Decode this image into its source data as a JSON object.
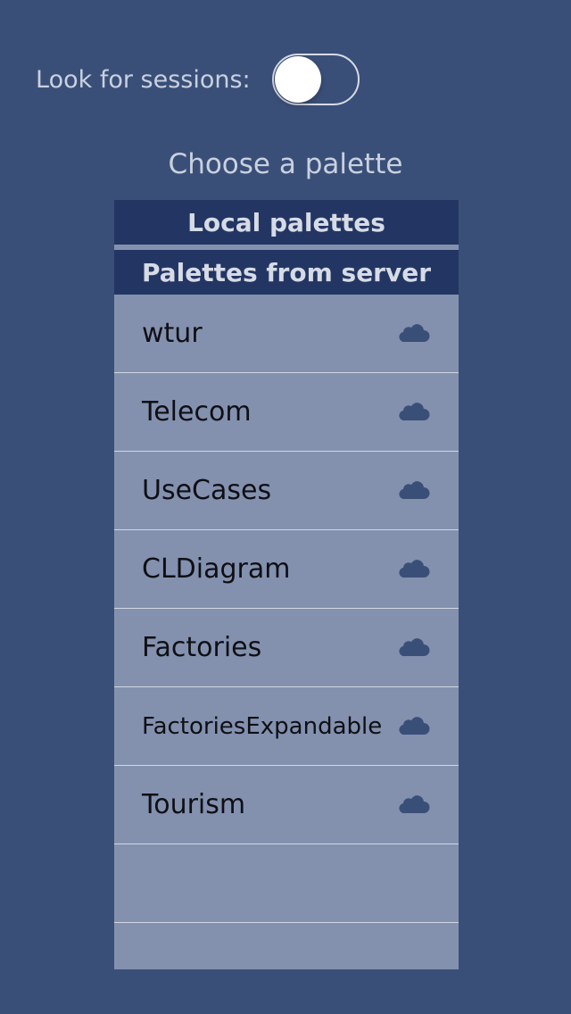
{
  "session": {
    "label": "Look for sessions:",
    "toggle_on": false
  },
  "choose_title": "Choose a palette",
  "sections": {
    "local": "Local palettes",
    "server": "Palettes from server"
  },
  "palettes": [
    {
      "name": "wtur",
      "icon": "cloud-icon"
    },
    {
      "name": "Telecom",
      "icon": "cloud-icon"
    },
    {
      "name": "UseCases",
      "icon": "cloud-icon"
    },
    {
      "name": "CLDiagram",
      "icon": "cloud-icon"
    },
    {
      "name": "Factories",
      "icon": "cloud-icon"
    },
    {
      "name": "FactoriesExpandable",
      "icon": "cloud-icon"
    },
    {
      "name": "Tourism",
      "icon": "cloud-icon"
    }
  ],
  "colors": {
    "background": "#3a4f78",
    "header": "#233663",
    "list": "#8391af",
    "cloud": "#3a4f78"
  }
}
